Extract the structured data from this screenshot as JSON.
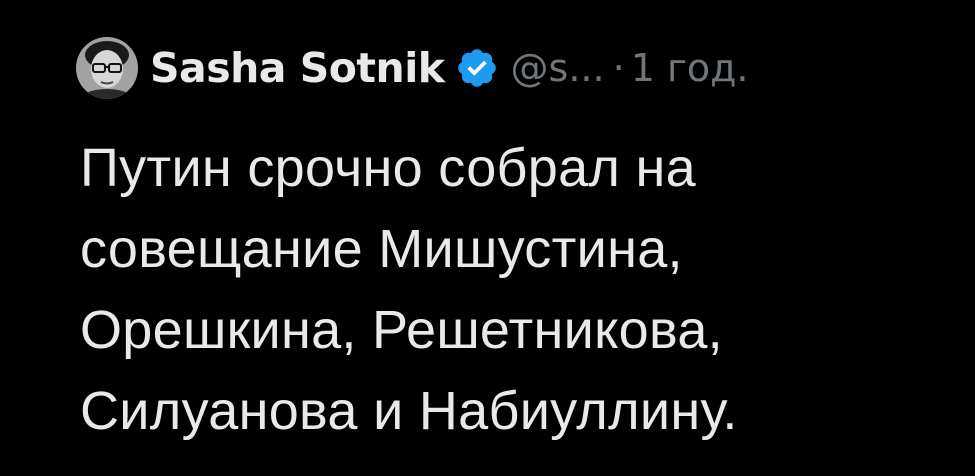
{
  "tweet": {
    "author": {
      "display_name": "Sasha Sotnik",
      "handle": "@s...",
      "avatar_icon": "user-avatar",
      "verified_icon": "verified-badge-icon"
    },
    "separator": "·",
    "timestamp": "1 год.",
    "text_lines": [
      "Путин срочно собрал на",
      "совещание Мишустина,",
      "Орешкина, Решетникова,",
      "Силуанова и Набиуллину."
    ]
  },
  "colors": {
    "background": "#000000",
    "primary_text": "#e7e9ea",
    "secondary_text": "#71767b",
    "verified_badge": "#1d9bf0"
  }
}
